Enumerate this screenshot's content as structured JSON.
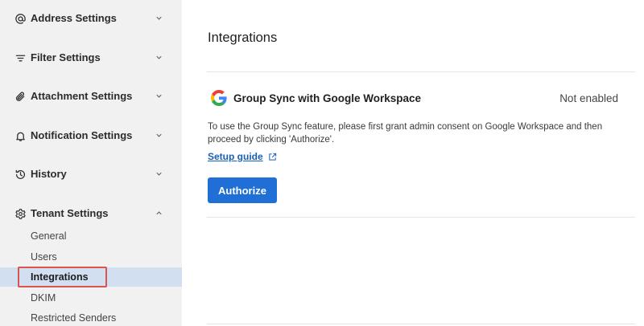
{
  "sidebar": {
    "sections": [
      {
        "label": "Address Settings",
        "icon": "at-sign-icon",
        "expanded": false
      },
      {
        "label": "Filter Settings",
        "icon": "filter-icon",
        "expanded": false
      },
      {
        "label": "Attachment Settings",
        "icon": "paperclip-icon",
        "expanded": false
      },
      {
        "label": "Notification Settings",
        "icon": "bell-icon",
        "expanded": false
      },
      {
        "label": "History",
        "icon": "history-icon",
        "expanded": false
      },
      {
        "label": "Tenant Settings",
        "icon": "gear-icon",
        "expanded": true
      }
    ],
    "tenant_items": [
      {
        "label": "General",
        "active": false
      },
      {
        "label": "Users",
        "active": false
      },
      {
        "label": "Integrations",
        "active": true
      },
      {
        "label": "DKIM",
        "active": false
      },
      {
        "label": "Restricted Senders",
        "active": false
      }
    ]
  },
  "main": {
    "title": "Integrations",
    "integration": {
      "name": "Group Sync with Google Workspace",
      "status": "Not enabled",
      "description": "To use the Group Sync feature, please first grant admin consent on Google Workspace and then proceed by clicking 'Authorize'.",
      "guide_label": "Setup guide",
      "button_label": "Authorize"
    }
  },
  "colors": {
    "accent": "#1f6fd6",
    "link": "#1560bd",
    "active_bg": "#d1dff1",
    "highlight": "#d9534f"
  }
}
